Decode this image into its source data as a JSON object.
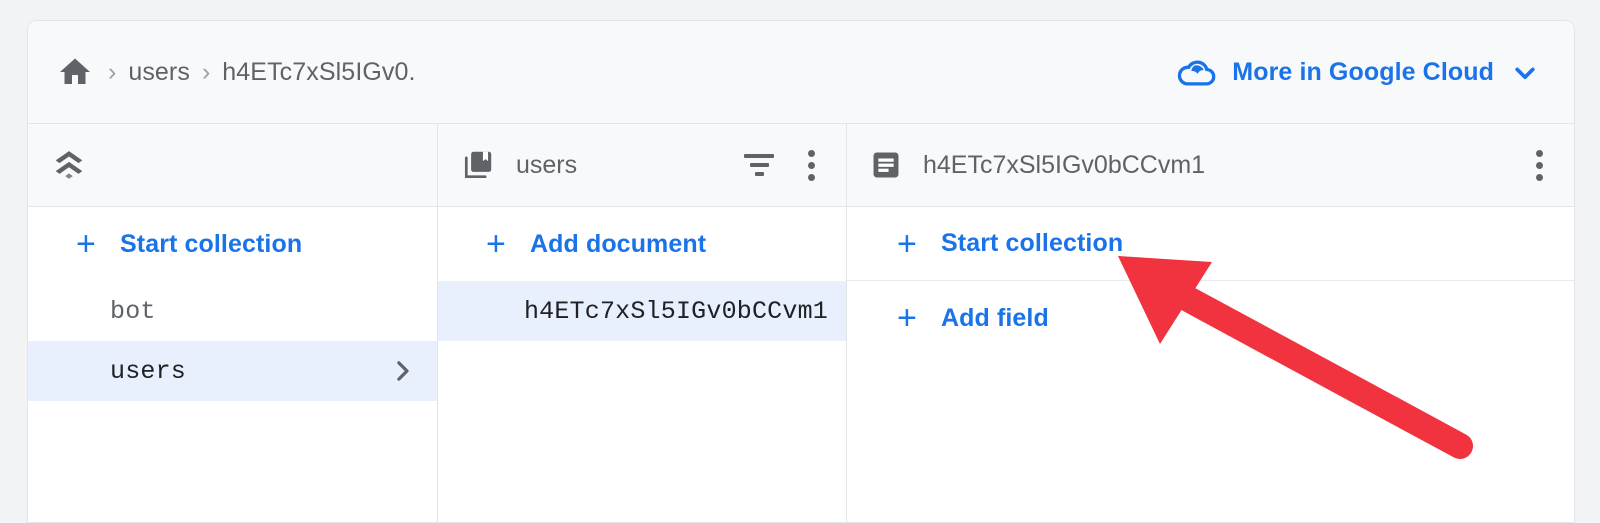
{
  "app": {
    "product": "Firestore Data Viewer",
    "background_color": "#f1f3f4",
    "accent_color": "#1a73e8",
    "selected_row_color": "#e8f0fe",
    "text_color": "#5f6368",
    "annotation_color": "#f0333f"
  },
  "breadcrumb": {
    "home_icon": "home-icon",
    "separator": "›",
    "items": [
      {
        "label": "users"
      },
      {
        "label": "h4ETc7xSl5IGv0."
      }
    ]
  },
  "header": {
    "more_in_cloud": {
      "icon": "cloud-icon",
      "label": "More in Google Cloud",
      "chevron": "chevron-down-icon"
    }
  },
  "panels": {
    "collections": {
      "header": {
        "icon": "firestore-database-icon",
        "title": ""
      },
      "actions": [
        {
          "icon": "plus-icon",
          "label": "Start collection"
        }
      ],
      "rows": [
        {
          "label": "bot",
          "selected": false,
          "chevron": false
        },
        {
          "label": "users",
          "selected": true,
          "chevron": true
        }
      ]
    },
    "documents": {
      "header": {
        "icon": "collection-icon",
        "title": "users",
        "filter_icon": "filter-icon",
        "menu_icon": "more-vert-icon"
      },
      "actions": [
        {
          "icon": "plus-icon",
          "label": "Add document"
        }
      ],
      "rows": [
        {
          "label": "h4ETc7xSl5IGv0bCCvm1",
          "selected": true,
          "chevron": false
        }
      ]
    },
    "fields": {
      "header": {
        "icon": "document-icon",
        "title": "h4ETc7xSl5IGv0bCCvm1",
        "menu_icon": "more-vert-icon"
      },
      "actions": [
        {
          "icon": "plus-icon",
          "label": "Start collection"
        },
        {
          "icon": "plus-icon",
          "label": "Add field"
        }
      ],
      "rows": []
    }
  },
  "annotation": {
    "type": "arrow",
    "color": "#f0333f",
    "points_to": "start-collection-in-fields-panel"
  }
}
